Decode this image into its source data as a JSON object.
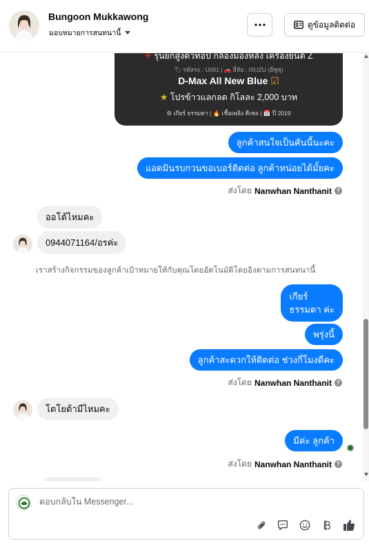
{
  "header": {
    "name": "Bungoon Mukkawong",
    "assign_label": "มอบหมายการสนทนานี้",
    "more_label": "···",
    "contact_label": "ดูข้อมูลติดต่อ"
  },
  "product_card": {
    "headline_star": "✳",
    "headline": "รุ่นยกสูงตัวท็อป กล้องมองหลัง เครื่องยนต์ Z",
    "meta": "🏷 รหัสรถ : U091 | 🚗 ยี่ห้อ : ISUZU (อีซูซุ)",
    "model": "D-Max All New Blue",
    "model_check": "☑",
    "promo_star": "★",
    "promo": "โปรข้าวแลกลด กิโลละ 2,000 บาท",
    "specs": "⚙ เกียร์ ธรรมดา  |  🔥 เชื้อเพลิง ดีเซล  |  📅 ปี 2019"
  },
  "messages": {
    "m1": "ลูกค้าสนใจเป็นคันนี้นะคะ",
    "m2": "แอดมินรบกวนขอเบอร์ติดต่อ ลูกค้าหน่อยได้มั้ยคะ",
    "in1": "ออโต้ไหมคะ",
    "in2": "0944071164/อรค่ะ",
    "notice": "เราสร้างกิจกรรมของลูกค้าเป้าหมายให้กับคุณโดยอัตโนมัติโดยอิงตามการสนทนานี้",
    "m3_line1": "เกียร์",
    "m3_line2": "ธรรมดา ค่ะ",
    "m4": "พรุ่งนี้",
    "m5": "ลูกค้าสะดวกให้ติดต่อ ช่วงกี่โมงดีคะ",
    "in3": "โตโยต้ามีไหมคะ",
    "m6": "มีค่ะ ลูกค้า"
  },
  "sent_by": {
    "prefix": "ส่งโดย",
    "agent": "Nanwhan Nanthanit",
    "help": "?"
  },
  "composer": {
    "placeholder": "ตอบกลับใน Messenger..."
  },
  "colors": {
    "outgoing": "#0a7cff",
    "incoming": "#f0f0f0",
    "card": "#2b2b2b"
  },
  "icons": [
    "more-icon",
    "contact-card-icon",
    "attach-icon",
    "saved-reply-icon",
    "emoji-icon",
    "baht-icon",
    "like-icon",
    "help-icon"
  ]
}
